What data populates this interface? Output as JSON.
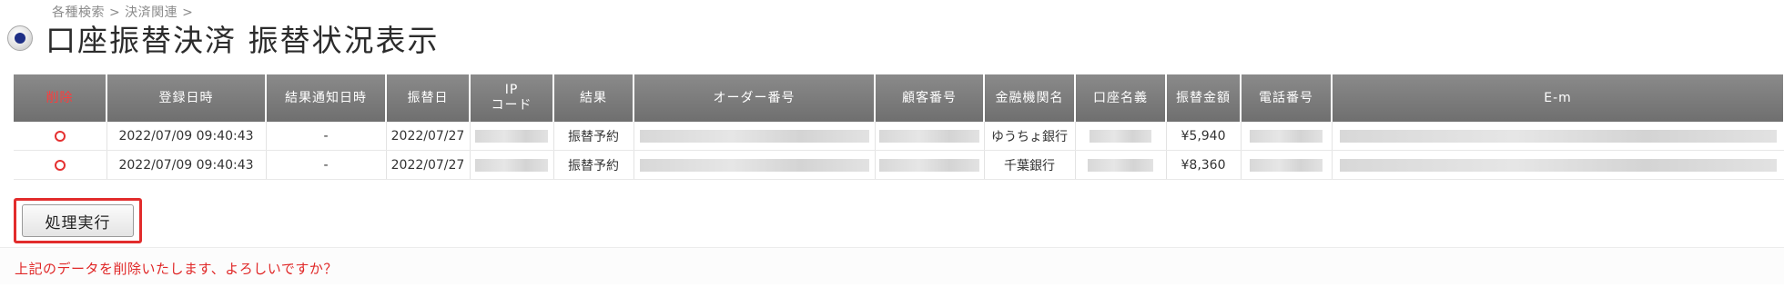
{
  "breadcrumb": "各種検索 > 決済関連 >",
  "page_title": "口座振替決済 振替状況表示",
  "table": {
    "columns": {
      "delete": "削除",
      "registered_at": "登録日時",
      "result_notified_at": "結果通知日時",
      "transfer_date": "振替日",
      "ip_code": "IP\nコード",
      "result": "結果",
      "order_number": "オーダー番号",
      "customer_number": "顧客番号",
      "institution_name": "金融機関名",
      "account_holder": "口座名義",
      "transfer_amount": "振替金額",
      "phone_number": "電話番号",
      "email": "E-m"
    },
    "rows": [
      {
        "registered_at": "2022/07/09 09:40:43",
        "result_notified_at": "-",
        "transfer_date": "2022/07/27",
        "result": "振替予約",
        "institution_name": "ゆうちょ銀行",
        "transfer_amount": "¥5,940"
      },
      {
        "registered_at": "2022/07/09 09:40:43",
        "result_notified_at": "-",
        "transfer_date": "2022/07/27",
        "result": "振替予約",
        "institution_name": "千葉銀行",
        "transfer_amount": "¥8,360"
      }
    ]
  },
  "execute_button": "処理実行",
  "confirm_message": "上記のデータを削除いたします、よろしいですか？",
  "colors": {
    "header_bg": "#7a7a7a",
    "delete_header": "#ff3b3b",
    "highlight_border": "#e22c2c",
    "warning_text": "#e02828"
  },
  "icons": {
    "title_icon": "radio-bullet-icon",
    "delete_mark": "circle-mark-icon"
  }
}
